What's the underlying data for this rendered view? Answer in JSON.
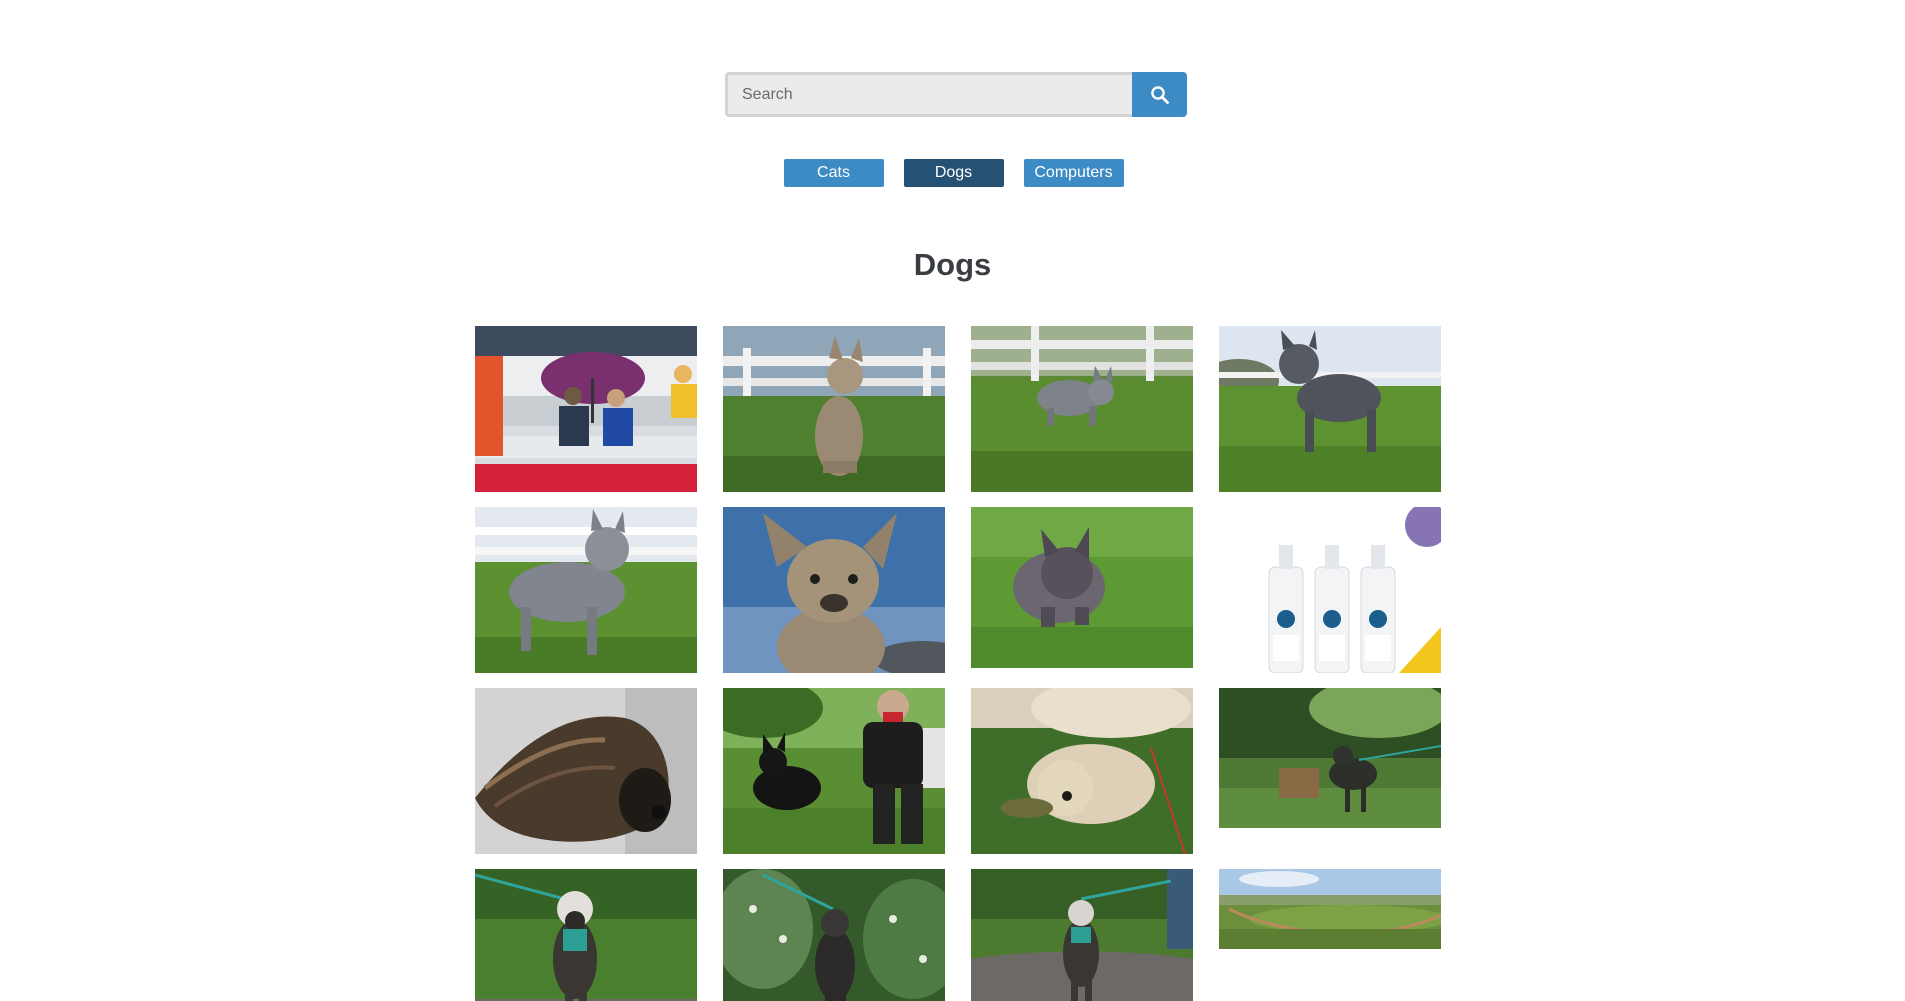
{
  "search": {
    "placeholder": "Search",
    "value": ""
  },
  "categories": [
    {
      "label": "Cats",
      "active": false
    },
    {
      "label": "Dogs",
      "active": true
    },
    {
      "label": "Computers",
      "active": false
    }
  ],
  "heading": "Dogs",
  "colors": {
    "accent": "#3d8bc4",
    "active": "#255174",
    "heading": "#3a3d42"
  },
  "gallery": [
    {
      "icon": "photo-crowd-umbrella"
    },
    {
      "icon": "photo-french-bulldog-fence"
    },
    {
      "icon": "photo-french-bulldog-field"
    },
    {
      "icon": "photo-french-bulldog-standing"
    },
    {
      "icon": "photo-french-bulldog-side"
    },
    {
      "icon": "photo-french-bulldog-sky"
    },
    {
      "icon": "photo-terrier-grass"
    },
    {
      "icon": "photo-shampoo-bottles"
    },
    {
      "icon": "photo-afghan-hound"
    },
    {
      "icon": "photo-woman-black-dog"
    },
    {
      "icon": "photo-doodle-toy"
    },
    {
      "icon": "photo-dog-meadow"
    },
    {
      "icon": "photo-shaggy-dog-path"
    },
    {
      "icon": "photo-dog-flowers"
    },
    {
      "icon": "photo-dog-running"
    },
    {
      "icon": "photo-landscape-field"
    }
  ]
}
